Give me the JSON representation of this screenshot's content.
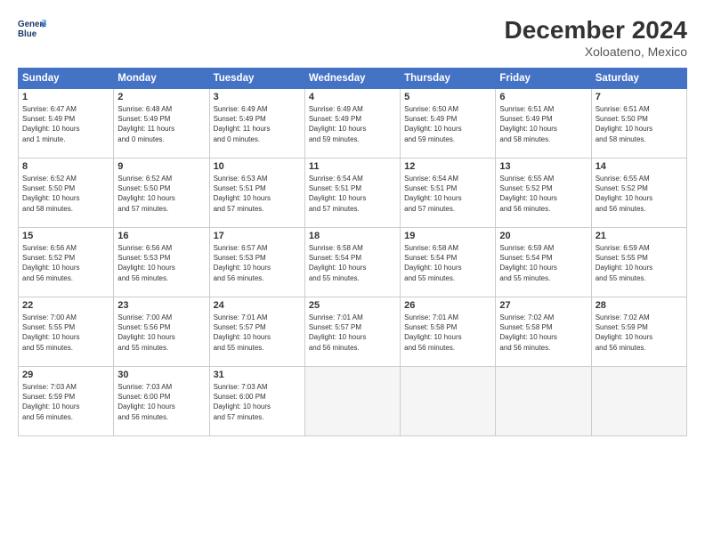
{
  "header": {
    "logo_line1": "General",
    "logo_line2": "Blue",
    "title": "December 2024",
    "subtitle": "Xoloateno, Mexico"
  },
  "days_of_week": [
    "Sunday",
    "Monday",
    "Tuesday",
    "Wednesday",
    "Thursday",
    "Friday",
    "Saturday"
  ],
  "weeks": [
    [
      {
        "day": 1,
        "sunrise": "6:47 AM",
        "sunset": "5:49 PM",
        "daylight": "10 hours and 1 minute."
      },
      {
        "day": 2,
        "sunrise": "6:48 AM",
        "sunset": "5:49 PM",
        "daylight": "11 hours and 0 minutes."
      },
      {
        "day": 3,
        "sunrise": "6:49 AM",
        "sunset": "5:49 PM",
        "daylight": "11 hours and 0 minutes."
      },
      {
        "day": 4,
        "sunrise": "6:49 AM",
        "sunset": "5:49 PM",
        "daylight": "10 hours and 59 minutes."
      },
      {
        "day": 5,
        "sunrise": "6:50 AM",
        "sunset": "5:49 PM",
        "daylight": "10 hours and 59 minutes."
      },
      {
        "day": 6,
        "sunrise": "6:51 AM",
        "sunset": "5:49 PM",
        "daylight": "10 hours and 58 minutes."
      },
      {
        "day": 7,
        "sunrise": "6:51 AM",
        "sunset": "5:50 PM",
        "daylight": "10 hours and 58 minutes."
      }
    ],
    [
      {
        "day": 8,
        "sunrise": "6:52 AM",
        "sunset": "5:50 PM",
        "daylight": "10 hours and 58 minutes."
      },
      {
        "day": 9,
        "sunrise": "6:52 AM",
        "sunset": "5:50 PM",
        "daylight": "10 hours and 57 minutes."
      },
      {
        "day": 10,
        "sunrise": "6:53 AM",
        "sunset": "5:51 PM",
        "daylight": "10 hours and 57 minutes."
      },
      {
        "day": 11,
        "sunrise": "6:54 AM",
        "sunset": "5:51 PM",
        "daylight": "10 hours and 57 minutes."
      },
      {
        "day": 12,
        "sunrise": "6:54 AM",
        "sunset": "5:51 PM",
        "daylight": "10 hours and 57 minutes."
      },
      {
        "day": 13,
        "sunrise": "6:55 AM",
        "sunset": "5:52 PM",
        "daylight": "10 hours and 56 minutes."
      },
      {
        "day": 14,
        "sunrise": "6:55 AM",
        "sunset": "5:52 PM",
        "daylight": "10 hours and 56 minutes."
      }
    ],
    [
      {
        "day": 15,
        "sunrise": "6:56 AM",
        "sunset": "5:52 PM",
        "daylight": "10 hours and 56 minutes."
      },
      {
        "day": 16,
        "sunrise": "6:56 AM",
        "sunset": "5:53 PM",
        "daylight": "10 hours and 56 minutes."
      },
      {
        "day": 17,
        "sunrise": "6:57 AM",
        "sunset": "5:53 PM",
        "daylight": "10 hours and 56 minutes."
      },
      {
        "day": 18,
        "sunrise": "6:58 AM",
        "sunset": "5:54 PM",
        "daylight": "10 hours and 55 minutes."
      },
      {
        "day": 19,
        "sunrise": "6:58 AM",
        "sunset": "5:54 PM",
        "daylight": "10 hours and 55 minutes."
      },
      {
        "day": 20,
        "sunrise": "6:59 AM",
        "sunset": "5:54 PM",
        "daylight": "10 hours and 55 minutes."
      },
      {
        "day": 21,
        "sunrise": "6:59 AM",
        "sunset": "5:55 PM",
        "daylight": "10 hours and 55 minutes."
      }
    ],
    [
      {
        "day": 22,
        "sunrise": "7:00 AM",
        "sunset": "5:55 PM",
        "daylight": "10 hours and 55 minutes."
      },
      {
        "day": 23,
        "sunrise": "7:00 AM",
        "sunset": "5:56 PM",
        "daylight": "10 hours and 55 minutes."
      },
      {
        "day": 24,
        "sunrise": "7:01 AM",
        "sunset": "5:57 PM",
        "daylight": "10 hours and 55 minutes."
      },
      {
        "day": 25,
        "sunrise": "7:01 AM",
        "sunset": "5:57 PM",
        "daylight": "10 hours and 56 minutes."
      },
      {
        "day": 26,
        "sunrise": "7:01 AM",
        "sunset": "5:58 PM",
        "daylight": "10 hours and 56 minutes."
      },
      {
        "day": 27,
        "sunrise": "7:02 AM",
        "sunset": "5:58 PM",
        "daylight": "10 hours and 56 minutes."
      },
      {
        "day": 28,
        "sunrise": "7:02 AM",
        "sunset": "5:59 PM",
        "daylight": "10 hours and 56 minutes."
      }
    ],
    [
      {
        "day": 29,
        "sunrise": "7:03 AM",
        "sunset": "5:59 PM",
        "daylight": "10 hours and 56 minutes."
      },
      {
        "day": 30,
        "sunrise": "7:03 AM",
        "sunset": "6:00 PM",
        "daylight": "10 hours and 56 minutes."
      },
      {
        "day": 31,
        "sunrise": "7:03 AM",
        "sunset": "6:00 PM",
        "daylight": "10 hours and 57 minutes."
      },
      null,
      null,
      null,
      null
    ]
  ]
}
